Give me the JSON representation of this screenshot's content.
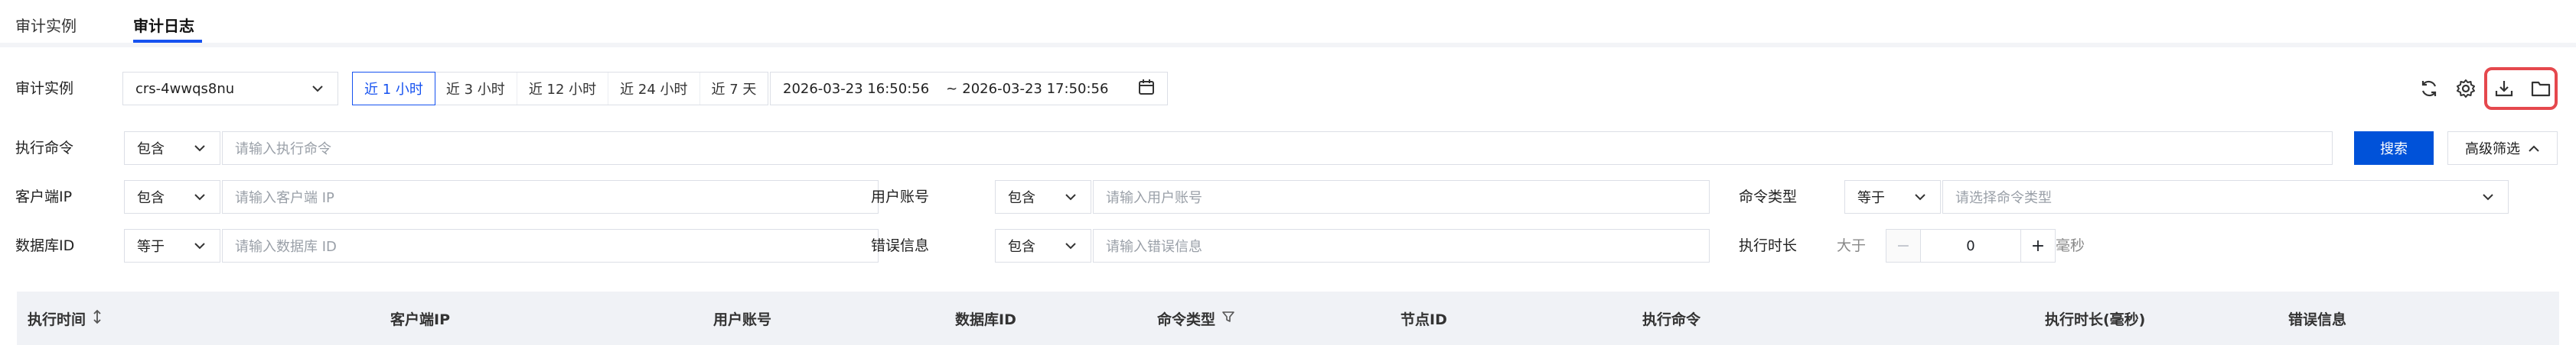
{
  "tabs": [
    {
      "label": "审计实例",
      "active": false
    },
    {
      "label": "审计日志",
      "active": true
    }
  ],
  "filters": {
    "instance_label": "审计实例",
    "instance_value": "crs-4wwqs8nu",
    "time_ranges": [
      "近 1 小时",
      "近 3 小时",
      "近 12 小时",
      "近 24 小时",
      "近 7 天"
    ],
    "active_time_range": "近 1 小时",
    "date_start": "2026-03-23 16:50:56",
    "date_sep": "~",
    "date_end": "2026-03-23 17:50:56",
    "command_label": "执行命令",
    "command_op": "包含",
    "command_placeholder": "请输入执行命令",
    "search_label": "搜索",
    "advanced_label": "高级筛选",
    "client_ip_label": "客户端IP",
    "client_ip_op": "包含",
    "client_ip_placeholder": "请输入客户端 IP",
    "user_label": "用户账号",
    "user_op": "包含",
    "user_placeholder": "请输入用户账号",
    "cmd_type_label": "命令类型",
    "cmd_type_op": "等于",
    "cmd_type_placeholder": "请选择命令类型",
    "db_label": "数据库ID",
    "db_op": "等于",
    "db_placeholder": "请输入数据库 ID",
    "error_label": "错误信息",
    "error_op": "包含",
    "error_placeholder": "请输入错误信息",
    "duration_label": "执行时长",
    "duration_op": "大于",
    "duration_minus": "−",
    "duration_value": "0",
    "duration_plus": "+",
    "duration_unit": "毫秒"
  },
  "toolbar_icons": [
    "refresh-icon",
    "gear-icon",
    "download-icon",
    "folder-icon"
  ],
  "table": {
    "columns": [
      {
        "label": "执行时间",
        "sortable": true
      },
      {
        "label": "客户端IP"
      },
      {
        "label": "用户账号"
      },
      {
        "label": "数据库ID"
      },
      {
        "label": "命令类型",
        "filterable": true
      },
      {
        "label": "节点ID"
      },
      {
        "label": "执行命令"
      },
      {
        "label": "执行时长(毫秒)"
      },
      {
        "label": "错误信息"
      }
    ]
  },
  "colors": {
    "accent": "#1652f0",
    "primary_button": "#0052d9",
    "highlight": "#e5484d",
    "header_bg": "#f0f2f6",
    "page_bg": "#f3f4f7"
  }
}
